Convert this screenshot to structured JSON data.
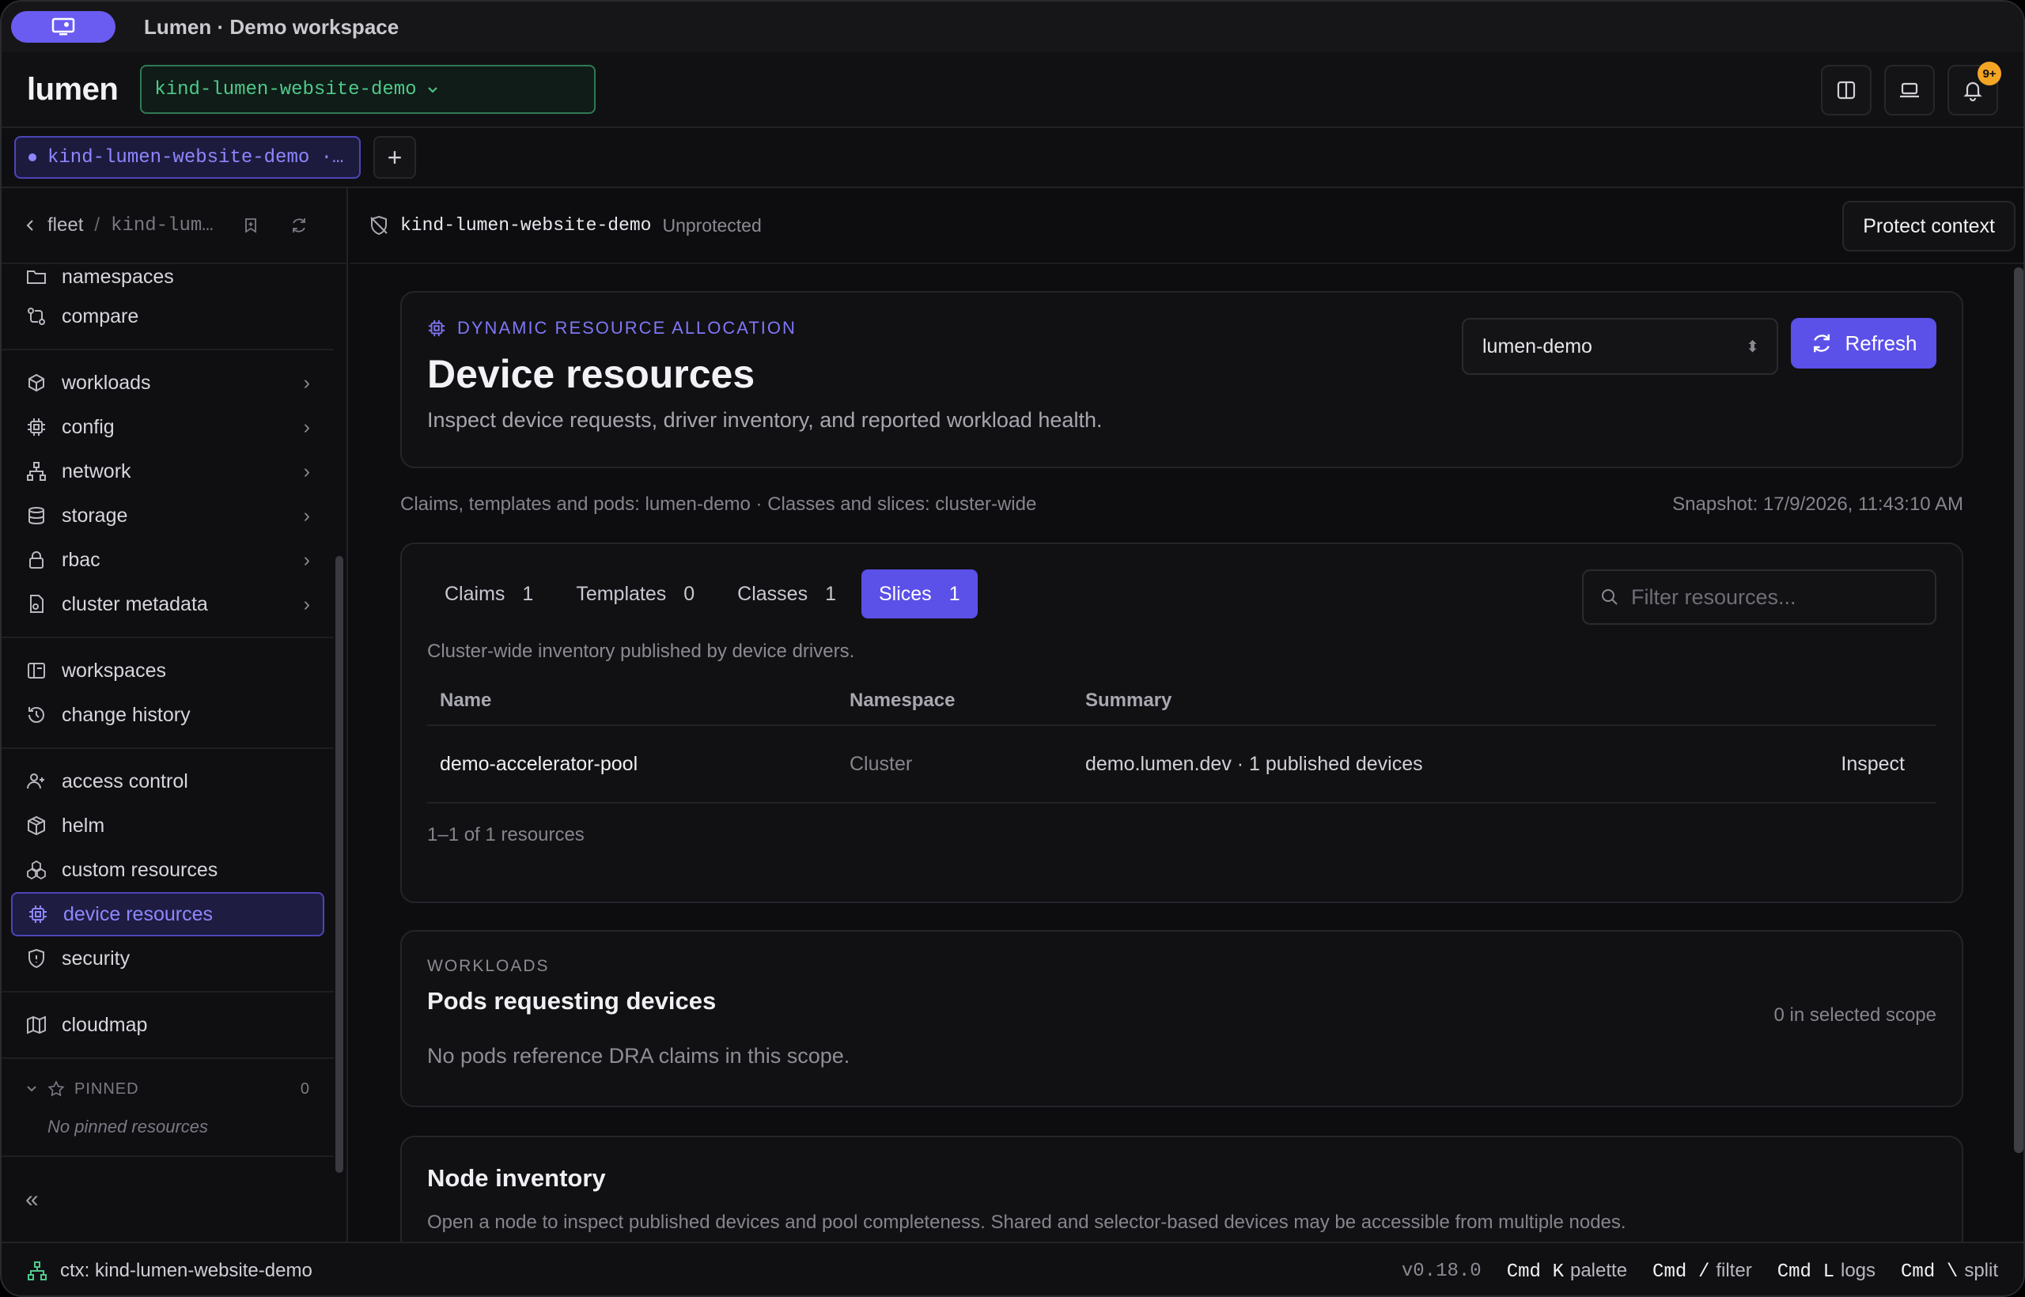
{
  "window": {
    "title": "Lumen · Demo workspace"
  },
  "header": {
    "logo": "lumen",
    "context_selector": "kind-lumen-website-demo",
    "notifications_badge": "9+"
  },
  "tabs": {
    "workspace_tab": "kind-lumen-website-demo ·…",
    "add_tab": "+"
  },
  "sidebar": {
    "breadcrumb": {
      "root": "fleet",
      "separator": "/",
      "current": "kind-lum…"
    },
    "items": [
      {
        "label": "namespaces",
        "icon": "folder-icon"
      },
      {
        "label": "compare",
        "icon": "compare-icon"
      },
      {
        "label": "workloads",
        "icon": "workloads-icon"
      },
      {
        "label": "config",
        "icon": "chip-icon"
      },
      {
        "label": "network",
        "icon": "network-icon"
      },
      {
        "label": "storage",
        "icon": "database-icon"
      },
      {
        "label": "rbac",
        "icon": "lock-icon"
      },
      {
        "label": "cluster metadata",
        "icon": "file-tag-icon"
      },
      {
        "label": "workspaces",
        "icon": "workspace-icon"
      },
      {
        "label": "change history",
        "icon": "history-icon"
      },
      {
        "label": "access control",
        "icon": "user-plus-icon"
      },
      {
        "label": "helm",
        "icon": "package-icon"
      },
      {
        "label": "custom resources",
        "icon": "cubes-icon"
      },
      {
        "label": "device resources",
        "icon": "chip-icon"
      },
      {
        "label": "security",
        "icon": "shield-icon"
      },
      {
        "label": "cloudmap",
        "icon": "map-icon"
      }
    ],
    "pinned": {
      "label": "PINNED",
      "count": "0",
      "empty": "No pinned resources"
    },
    "collapse": "«"
  },
  "context_bar": {
    "name": "kind-lumen-website-demo",
    "status": "Unprotected",
    "protect_button": "Protect context"
  },
  "hero": {
    "eyebrow": "DYNAMIC RESOURCE ALLOCATION",
    "title": "Device resources",
    "subtitle": "Inspect device requests, driver inventory, and reported workload health.",
    "namespace_select": "lumen-demo",
    "refresh_button": "Refresh"
  },
  "scope": {
    "text": "Claims, templates and pods: lumen-demo · Classes and slices: cluster-wide",
    "snapshot": "Snapshot: 17/9/2026, 11:43:10 AM"
  },
  "resource_tabs": [
    {
      "label": "Claims",
      "count": "1"
    },
    {
      "label": "Templates",
      "count": "0"
    },
    {
      "label": "Classes",
      "count": "1"
    },
    {
      "label": "Slices",
      "count": "1"
    }
  ],
  "filter": {
    "placeholder": "Filter resources..."
  },
  "table": {
    "description": "Cluster-wide inventory published by device drivers.",
    "columns": [
      "Name",
      "Namespace",
      "Summary"
    ],
    "rows": [
      {
        "name": "demo-accelerator-pool",
        "namespace": "Cluster",
        "summary": "demo.lumen.dev · 1 published devices",
        "action": "Inspect"
      }
    ],
    "footer": "1–1 of 1 resources"
  },
  "pods": {
    "eyebrow": "WORKLOADS",
    "title": "Pods requesting devices",
    "count": "0 in selected scope",
    "empty": "No pods reference DRA claims in this scope."
  },
  "nodes": {
    "title": "Node inventory",
    "description": "Open a node to inspect published devices and pool completeness. Shared and selector-based devices may be accessible from multiple nodes."
  },
  "statusbar": {
    "context": "ctx: kind-lumen-website-demo",
    "version": "v0.18.0",
    "shortcuts": [
      {
        "mod": "Cmd",
        "key": "K",
        "label": "palette"
      },
      {
        "mod": "Cmd",
        "key": "/",
        "label": "filter"
      },
      {
        "mod": "Cmd",
        "key": "L",
        "label": "logs"
      },
      {
        "mod": "Cmd",
        "key": "\\",
        "label": "split"
      }
    ]
  },
  "colors": {
    "accent": "#5b50e8",
    "accent_text": "#8e86ff",
    "context_green": "#4fc98b",
    "badge": "#f5a524"
  }
}
